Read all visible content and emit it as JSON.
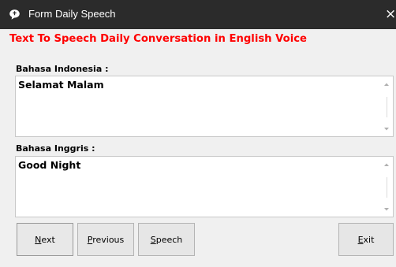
{
  "window": {
    "title": "Form Daily Speech",
    "close_glyph": "×",
    "app_icon": "speech-bubble-icon"
  },
  "heading": "Text To Speech Daily Conversation in English Voice",
  "fields": [
    {
      "label": "Bahasa Indonesia :",
      "value": "Selamat Malam"
    },
    {
      "label": "Bahasa Inggris :",
      "value": "Good Night"
    }
  ],
  "buttons": {
    "next": {
      "accel": "N",
      "rest": "ext"
    },
    "previous": {
      "accel": "P",
      "rest": "revious"
    },
    "speech": {
      "accel": "S",
      "rest": "peech"
    },
    "exit": {
      "accel": "E",
      "rest": "xit"
    }
  },
  "colors": {
    "titlebar": "#2b2b2b",
    "heading": "#ff0000",
    "window_bg": "#f0f0f0"
  }
}
